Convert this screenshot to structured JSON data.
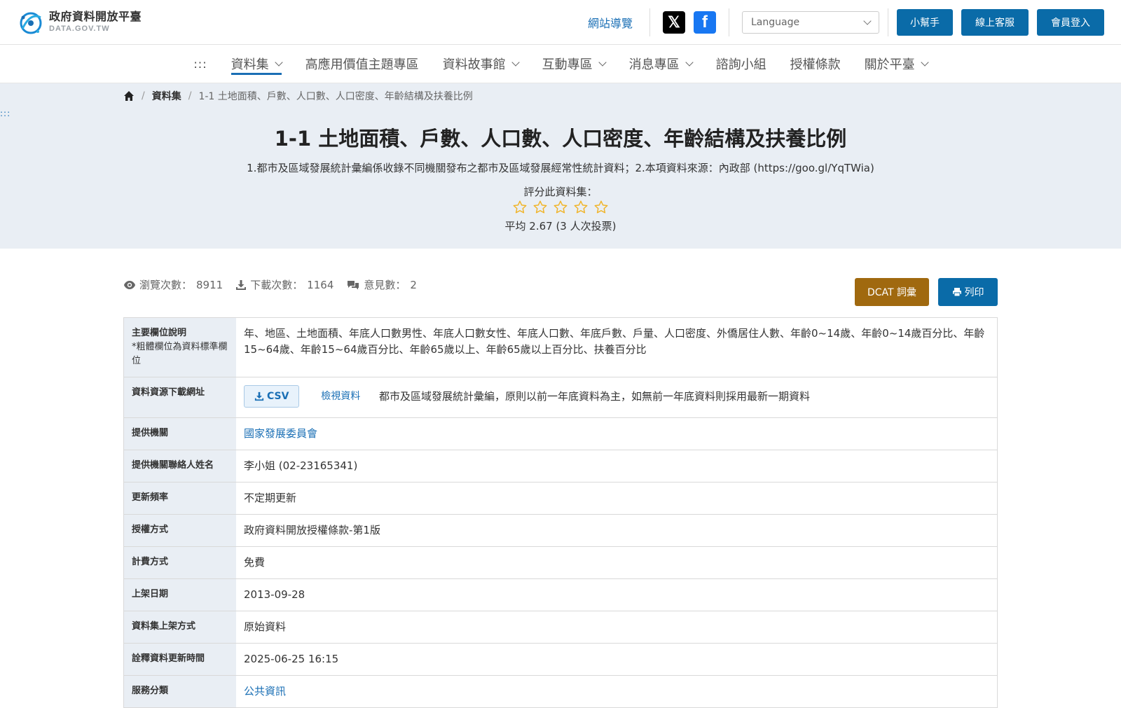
{
  "header": {
    "logo_cn": "政府資料開放平臺",
    "logo_en": "DATA.GOV.TW",
    "sitemap": "網站導覽",
    "language_placeholder": "Language",
    "helper": "小幫手",
    "online_service": "線上客服",
    "login": "會員登入"
  },
  "nav": {
    "accesskey": ":::",
    "items": [
      {
        "label": "資料集"
      },
      {
        "label": "高應用價值主題專區"
      },
      {
        "label": "資料故事館"
      },
      {
        "label": "互動專區"
      },
      {
        "label": "消息專區"
      },
      {
        "label": "諮詢小組"
      },
      {
        "label": "授權條款"
      },
      {
        "label": "關於平臺"
      }
    ]
  },
  "breadcrumb": {
    "level1": "資料集",
    "current": "1-1 土地面積、戶數、人口數、人口密度、年齡結構及扶養比例"
  },
  "hero": {
    "accesskey": ":::",
    "title": "1-1 土地面積、戶數、人口數、人口密度、年齡結構及扶養比例",
    "description": "1.都市及區域發展統計彙編係收錄不同機關發布之都市及區域發展經常性統計資料；2.本項資料來源：內政部 (https://goo.gl/YqTWia)",
    "rate_label": "評分此資料集：",
    "average": "平均 2.67 (3 人次投票)",
    "star_color": "#f0b429"
  },
  "stats": {
    "views_label": "瀏覽次數：",
    "views": "8911",
    "downloads_label": "下載次數：",
    "downloads": "1164",
    "comments_label": "意見數：",
    "comments": "2"
  },
  "actions": {
    "dcat": "DCAT 詞彙",
    "print": "列印"
  },
  "table": {
    "fields_label": "主要欄位說明",
    "fields_note": "*粗體欄位為資料標準欄位",
    "fields_value": "年、地區、土地面積、年底人口數男性、年底人口數女性、年底人口數、年底戶數、戶量、人口密度、外僑居住人數、年齡0~14歲、年齡0~14歲百分比、年齡15~64歲、年齡15~64歲百分比、年齡65歲以上、年齡65歲以上百分比、扶養百分比",
    "download_label": "資料資源下載網址",
    "csv": "CSV",
    "view_data": "檢視資料",
    "resource_desc": "都市及區域發展統計彙編，原則以前一年底資料為主，如無前一年底資料則採用最新一期資料",
    "provider_label": "提供機關",
    "provider": "國家發展委員會",
    "contact_label": "提供機關聯絡人姓名",
    "contact": "李小姐 (02-23165341)",
    "frequency_label": "更新頻率",
    "frequency": "不定期更新",
    "license_label": "授權方式",
    "license": "政府資料開放授權條款-第1版",
    "fee_label": "計費方式",
    "fee": "免費",
    "published_label": "上架日期",
    "published": "2013-09-28",
    "method_label": "資料集上架方式",
    "method": "原始資料",
    "meta_updated_label": "詮釋資料更新時間",
    "meta_updated": "2025-06-25 16:15",
    "category_label": "服務分類",
    "category": "公共資訊"
  }
}
